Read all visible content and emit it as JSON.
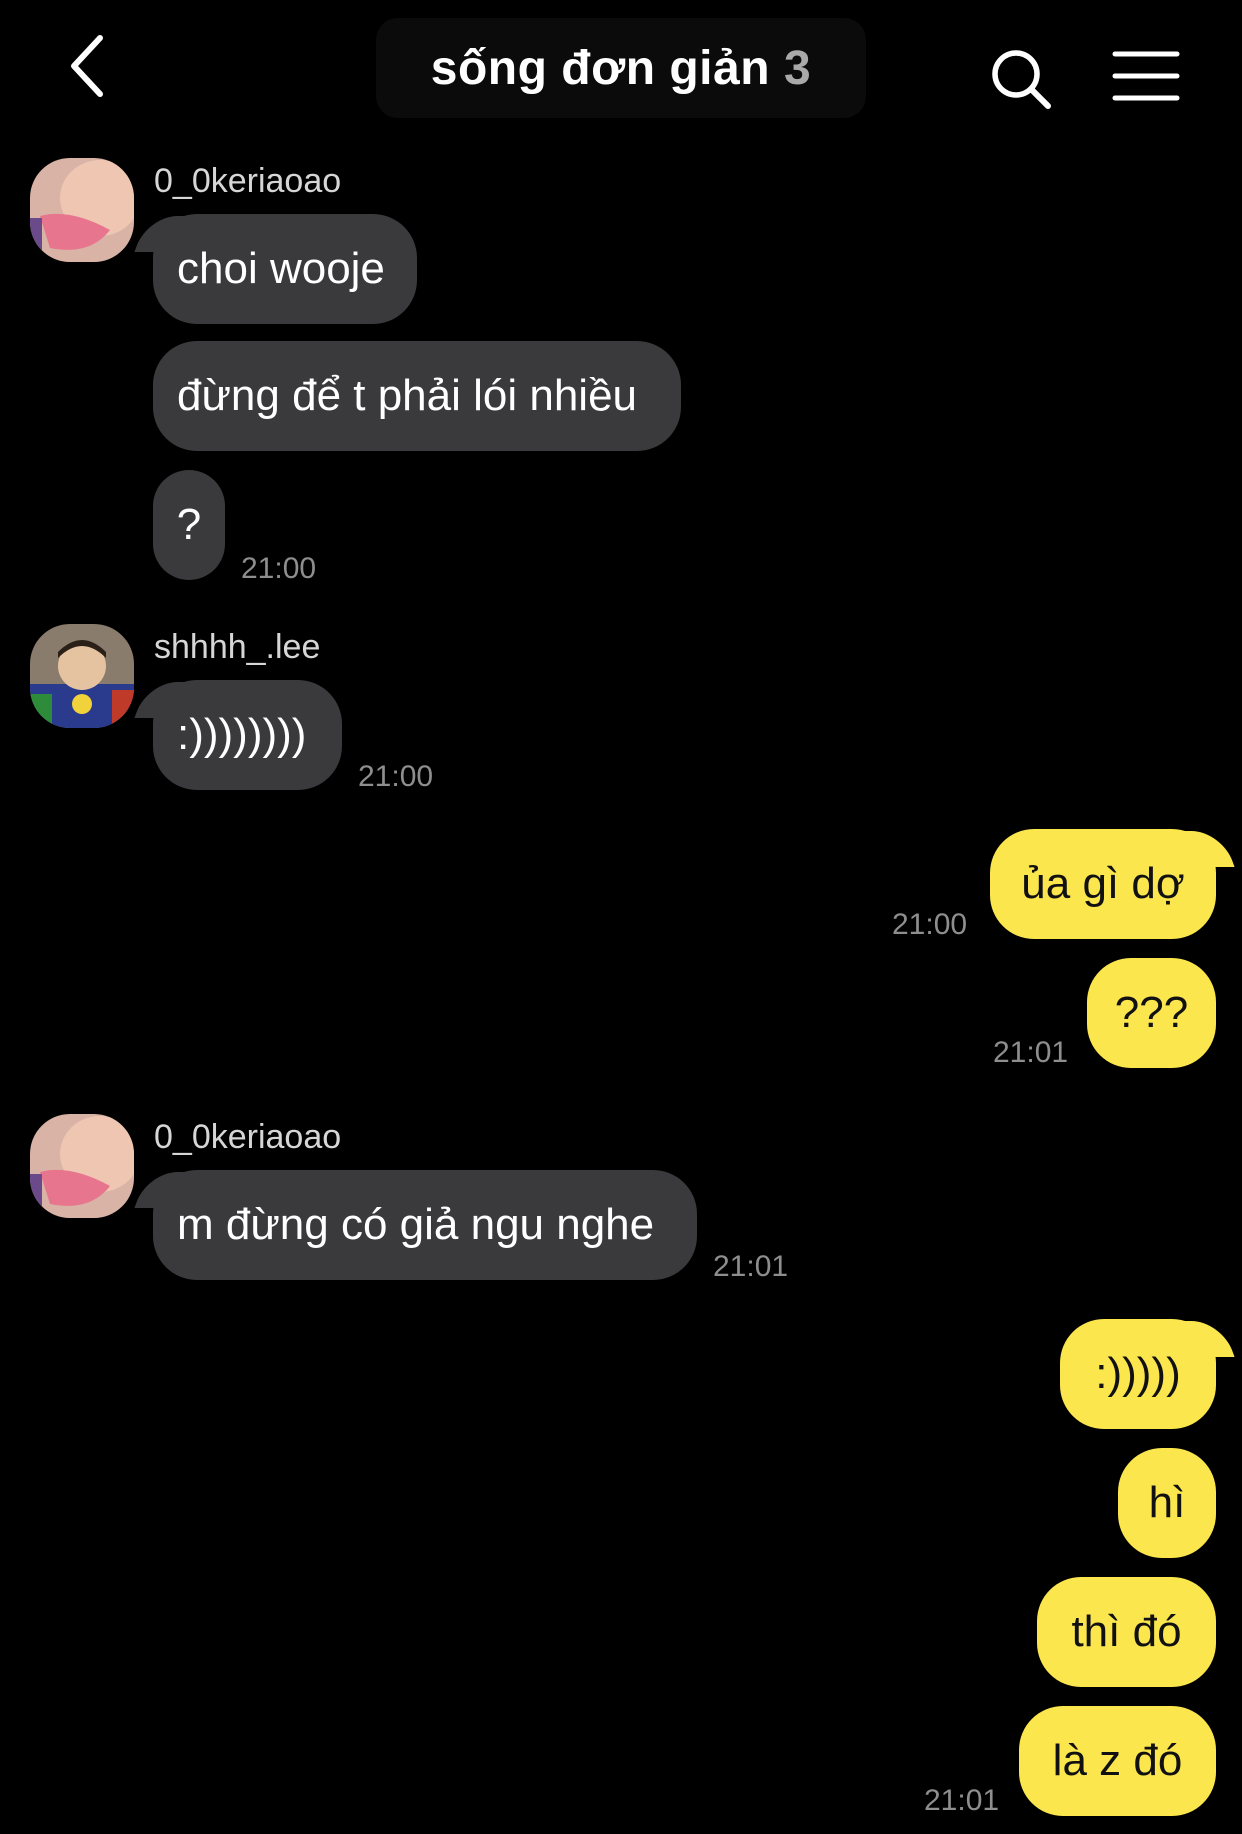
{
  "header": {
    "title": "sống đơn giản",
    "member_count": "3",
    "back_icon": "chevron-left-icon",
    "search_icon": "search-icon",
    "menu_icon": "hamburger-menu-icon"
  },
  "messages": {
    "g1": {
      "sender": "0_0keriaoao",
      "m1": "choi wooje",
      "m2": "đừng để t phải lói nhiều",
      "m3": "?",
      "time": "21:00"
    },
    "g2": {
      "sender": "shhhh_.lee",
      "m1": ":))))))))",
      "time": "21:00"
    },
    "g3": {
      "m1": "ủa gì dợ",
      "time1": "21:00",
      "m2": "???",
      "time2": "21:01"
    },
    "g4": {
      "sender": "0_0keriaoao",
      "m1": "m đừng có giả ngu nghe",
      "time": "21:01"
    },
    "g5": {
      "m1": ":)))))",
      "m2": "hì",
      "m3": "thì đó",
      "m4": "là z đó",
      "time": "21:01"
    }
  },
  "colors": {
    "background": "#000000",
    "incoming_bubble": "#3a3a3c",
    "outgoing_bubble": "#fbe64d",
    "timestamp": "#8e8e8e"
  }
}
